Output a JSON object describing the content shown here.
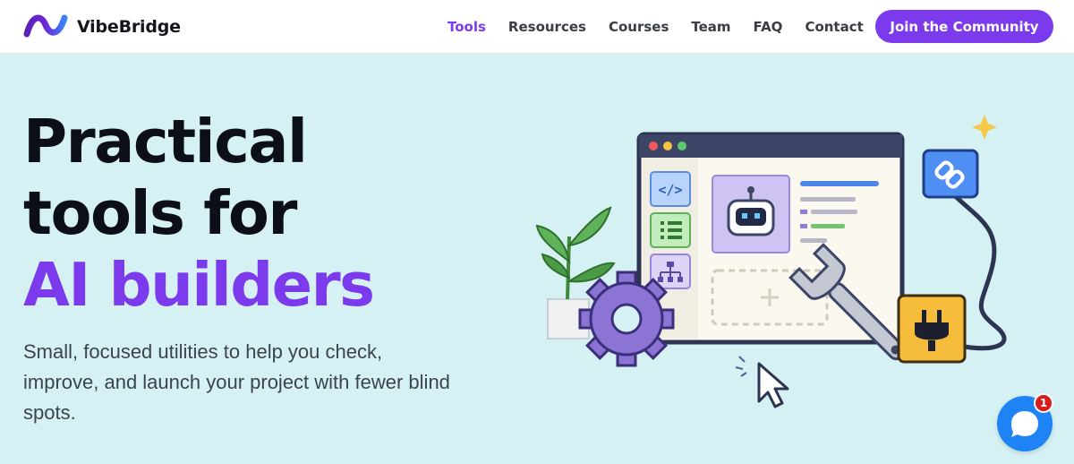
{
  "brand": {
    "name": "VibeBridge",
    "accent_color": "#7c3aed"
  },
  "nav": {
    "items": [
      {
        "label": "Tools",
        "active": true
      },
      {
        "label": "Resources",
        "active": false
      },
      {
        "label": "Courses",
        "active": false
      },
      {
        "label": "Team",
        "active": false
      },
      {
        "label": "FAQ",
        "active": false
      },
      {
        "label": "Contact",
        "active": false
      }
    ],
    "cta_label": "Join the Community"
  },
  "hero": {
    "title_line1": "Practical",
    "title_line2": "tools for",
    "title_accent": "AI builders",
    "subtitle": "Small, focused utilities to help you check, improve, and launch your project with fewer blind spots."
  },
  "illustration": {
    "icons": [
      "code-icon",
      "list-icon",
      "sitemap-icon",
      "robot-icon",
      "gear-icon",
      "wrench-icon",
      "link-icon",
      "plug-icon",
      "cursor-icon",
      "plant-icon",
      "sparkle-icon"
    ]
  },
  "chat_widget": {
    "icon": "chat-bubble-icon",
    "badge_count": "1",
    "color": "#1e84f5"
  }
}
